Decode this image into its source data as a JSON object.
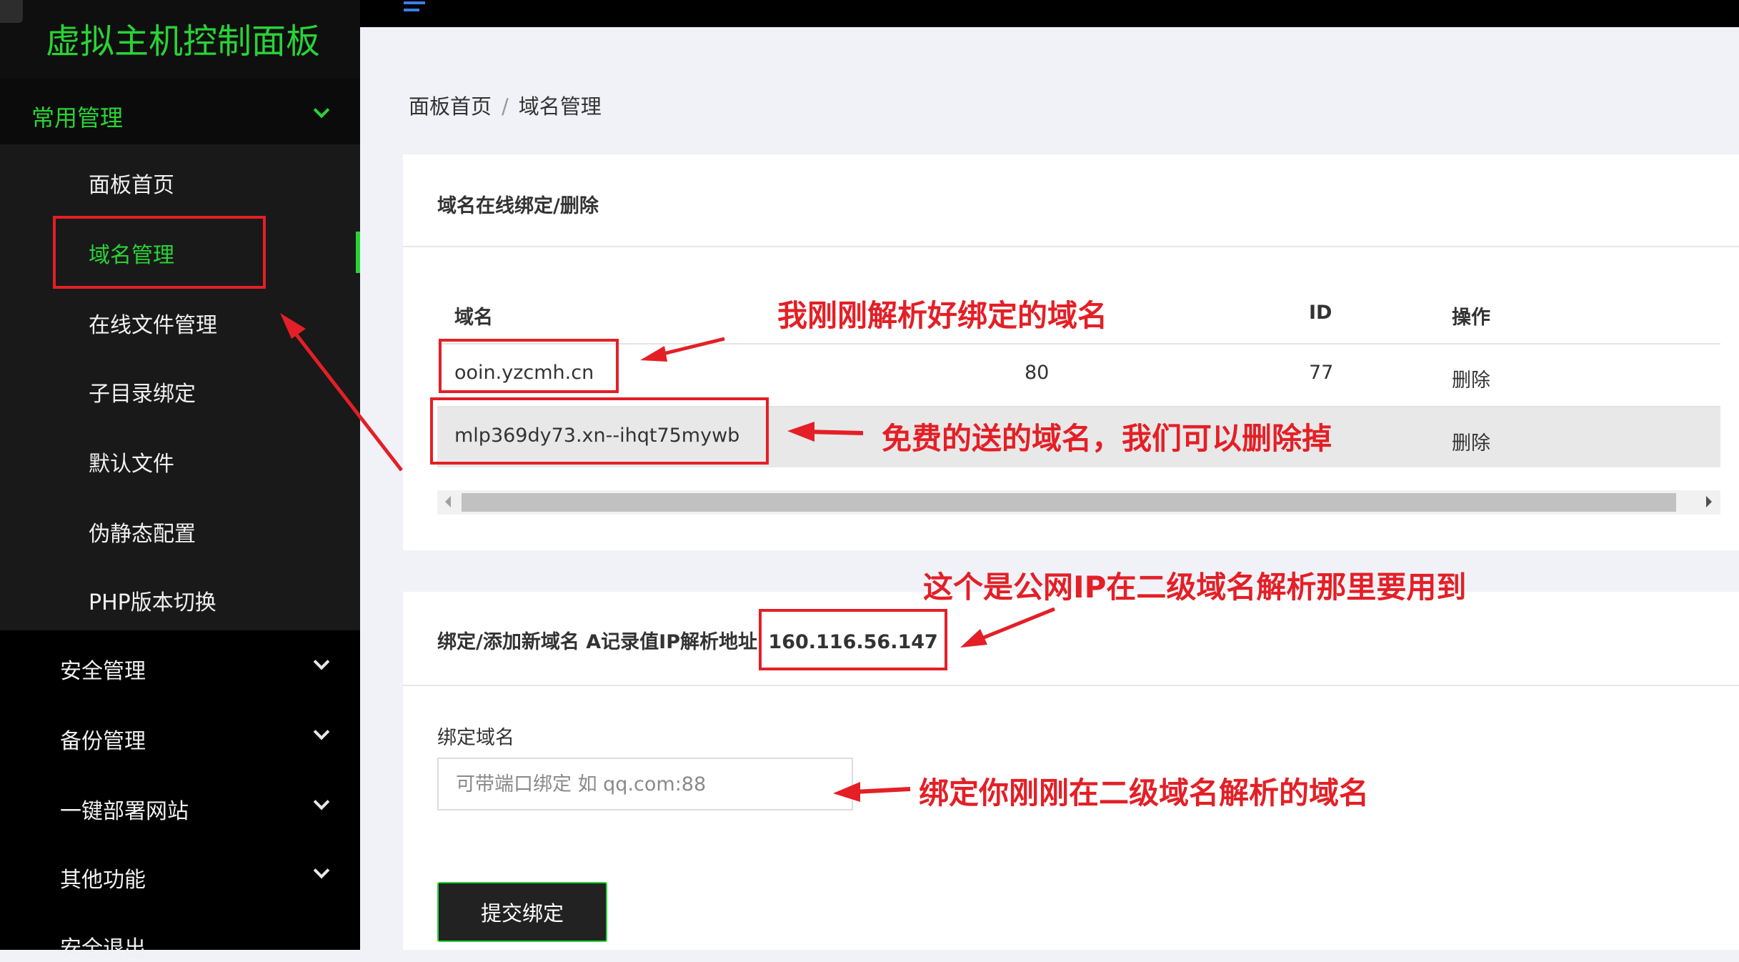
{
  "sidebar": {
    "brand": "虚拟主机控制面板",
    "open_group": "常用管理",
    "sub_items": [
      "面板首页",
      "域名管理",
      "在线文件管理",
      "子目录绑定",
      "默认文件",
      "伪静态配置",
      "PHP版本切换"
    ],
    "active_item": "域名管理",
    "groups": [
      "安全管理",
      "备份管理",
      "一键部署网站",
      "其他功能",
      "安全退出"
    ]
  },
  "breadcrumb": {
    "home": "面板首页",
    "separator": "/",
    "current": "域名管理"
  },
  "domain_card": {
    "title": "域名在线绑定/删除",
    "columns": [
      "域名",
      "",
      "ID",
      "操作"
    ],
    "rows": [
      {
        "domain": "ooin.yzcmh.cn",
        "port": "80",
        "id": "77",
        "action": "删除"
      },
      {
        "domain": "mlp369dy73.xn--ihqt75mywb",
        "port": "",
        "id": "",
        "action": "删除"
      }
    ]
  },
  "bind_card": {
    "title": "绑定/添加新域名 A记录值IP解析地址",
    "ip": "160.116.56.147",
    "field_label": "绑定域名",
    "field_placeholder": "可带端口绑定 如 qq.com:88",
    "field_value": "",
    "submit_label": "提交绑定"
  },
  "annotations": {
    "bound_domain": "我刚刚解析好绑定的域名",
    "free_domain": "免费的送的域名，我们可以删除掉",
    "public_ip": "这个是公网IP在二级域名解析那里要用到",
    "bind_hint": "绑定你刚刚在二级域名解析的域名",
    "color": "#e41f26"
  },
  "colors": {
    "accent": "#29d336",
    "sidebar_bg": "#000000",
    "submenu_bg": "#191919",
    "page_bg": "#f0f2f8"
  }
}
